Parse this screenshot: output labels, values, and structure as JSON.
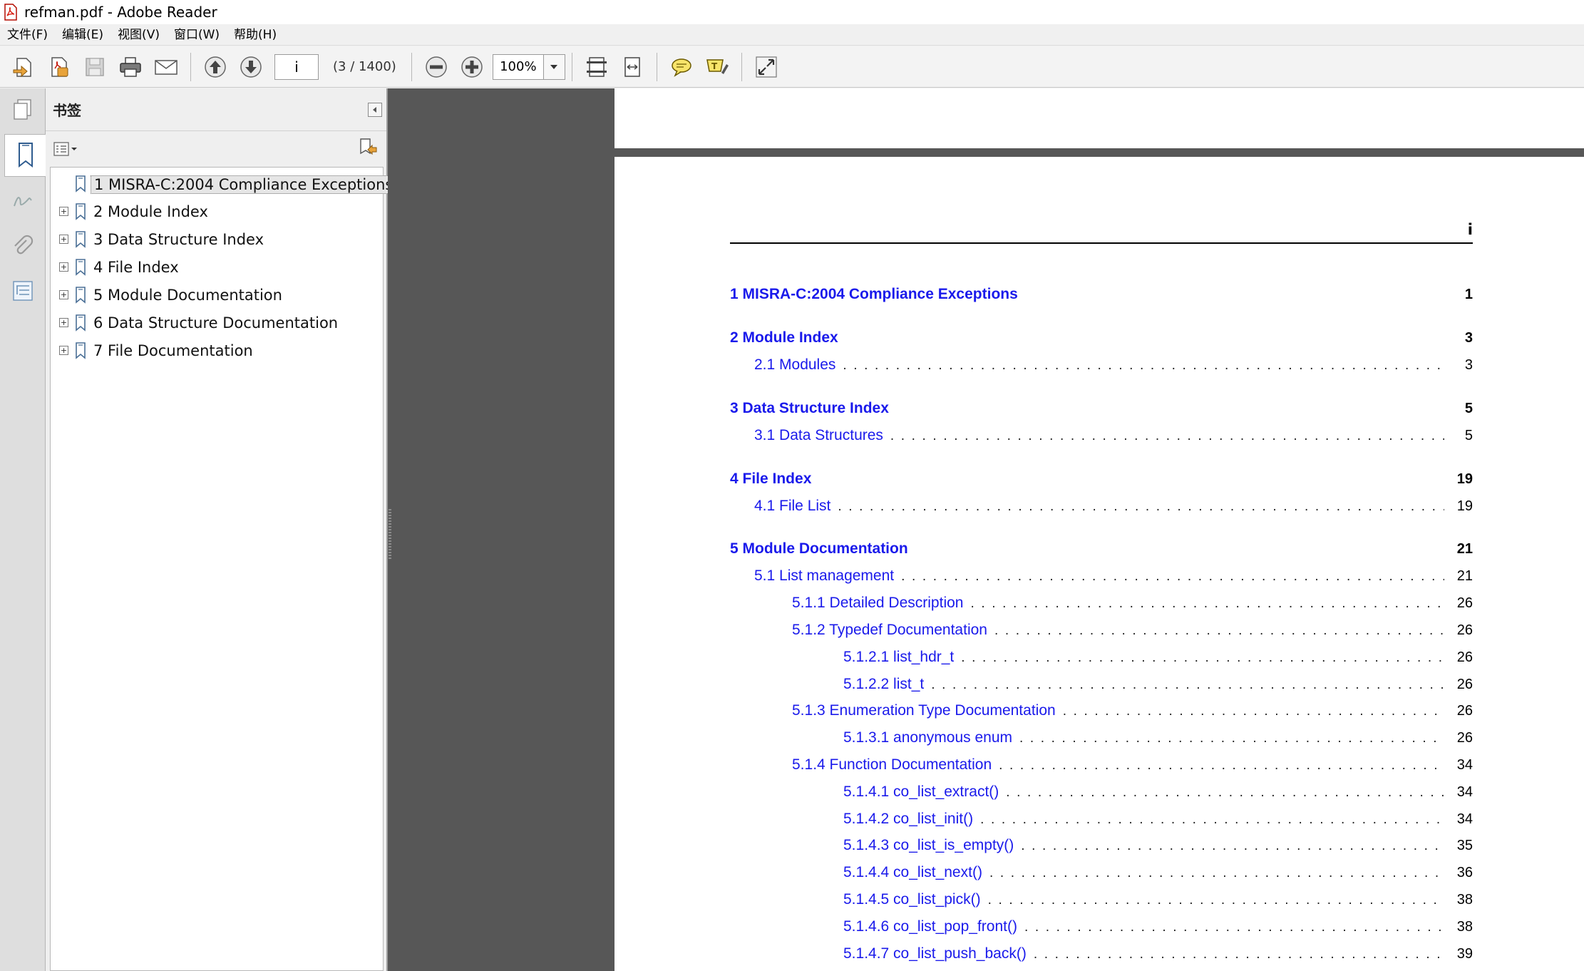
{
  "window": {
    "title": "refman.pdf - Adobe Reader"
  },
  "menu": [
    "文件(F)",
    "编辑(E)",
    "视图(V)",
    "窗口(W)",
    "帮助(H)"
  ],
  "toolbar": {
    "page_value": "i",
    "page_count": "(3 / 1400)",
    "zoom_value": "100%"
  },
  "bookmarks": {
    "title": "书签",
    "items": [
      {
        "label": "1 MISRA-C:2004 Compliance Exceptions",
        "expandable": false,
        "selected": true
      },
      {
        "label": "2 Module Index",
        "expandable": true
      },
      {
        "label": "3 Data Structure Index",
        "expandable": true
      },
      {
        "label": "4 File Index",
        "expandable": true
      },
      {
        "label": "5 Module Documentation",
        "expandable": true
      },
      {
        "label": "6 Data Structure Documentation",
        "expandable": true
      },
      {
        "label": "7 File Documentation",
        "expandable": true
      }
    ]
  },
  "document": {
    "page_header": "i",
    "toc": [
      {
        "level": 0,
        "title": "1 MISRA-C:2004 Compliance Exceptions",
        "page": "1"
      },
      {
        "level": 0,
        "title": "2 Module Index",
        "page": "3"
      },
      {
        "level": 1,
        "title": "2.1 Modules",
        "page": "3"
      },
      {
        "level": 0,
        "title": "3 Data Structure Index",
        "page": "5"
      },
      {
        "level": 1,
        "title": "3.1 Data Structures",
        "page": "5"
      },
      {
        "level": 0,
        "title": "4 File Index",
        "page": "19"
      },
      {
        "level": 1,
        "title": "4.1 File List",
        "page": "19"
      },
      {
        "level": 0,
        "title": "5 Module Documentation",
        "page": "21"
      },
      {
        "level": 1,
        "title": "5.1 List management",
        "page": "21"
      },
      {
        "level": 2,
        "title": "5.1.1 Detailed Description",
        "page": "26"
      },
      {
        "level": 2,
        "title": "5.1.2 Typedef Documentation",
        "page": "26"
      },
      {
        "level": 3,
        "title": "5.1.2.1 list_hdr_t",
        "page": "26"
      },
      {
        "level": 3,
        "title": "5.1.2.2 list_t",
        "page": "26"
      },
      {
        "level": 2,
        "title": "5.1.3 Enumeration Type Documentation",
        "page": "26"
      },
      {
        "level": 3,
        "title": "5.1.3.1 anonymous enum",
        "page": "26"
      },
      {
        "level": 2,
        "title": "5.1.4 Function Documentation",
        "page": "34"
      },
      {
        "level": 3,
        "title": "5.1.4.1 co_list_extract()",
        "page": "34"
      },
      {
        "level": 3,
        "title": "5.1.4.2 co_list_init()",
        "page": "34"
      },
      {
        "level": 3,
        "title": "5.1.4.3 co_list_is_empty()",
        "page": "35"
      },
      {
        "level": 3,
        "title": "5.1.4.4 co_list_next()",
        "page": "36"
      },
      {
        "level": 3,
        "title": "5.1.4.5 co_list_pick()",
        "page": "38"
      },
      {
        "level": 3,
        "title": "5.1.4.6 co_list_pop_front()",
        "page": "38"
      },
      {
        "level": 3,
        "title": "5.1.4.7 co_list_push_back()",
        "page": "39"
      }
    ]
  }
}
